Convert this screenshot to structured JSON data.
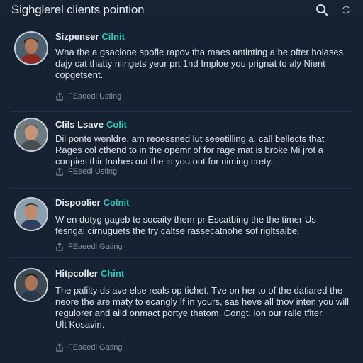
{
  "header": {
    "title": "Sighglerel clients pointion",
    "search_icon": "search-icon",
    "refresh_icon": "refresh-icon"
  },
  "cards": [
    {
      "name": "Sizpenser",
      "role": "Cilnit",
      "lines": [
        "Wna the a gsaclone spofle rapov tha maes antinting a be ofter holases",
        "dajy cat thatty nlingets yeur prt 1nd Imploe you prignat to aly Nient",
        "copgetsent."
      ],
      "meta": "FEaeedl Usting",
      "meta_icon": "share-icon"
    },
    {
      "name": "Clils Lsave",
      "role": "Colit",
      "lines": [
        "Dil ponte wenldre, am reoessned lut seeetilling a, call bellects that",
        "Rages col cthend to in the opemr of for rage mat is broke Mi jrot a",
        "conpies thir Inahes out the is you out for niming crety..."
      ],
      "meta": "FEeedl Usting",
      "meta_icon": "share-icon"
    },
    {
      "name": "Dispoolier",
      "role": "Colnit",
      "lines": [
        "W en dotyg gageb te socaity them pr Escatbing the the timer Us",
        "fesngal cirnuguets the try caltse rassecatnohe sof rigltsaibe."
      ],
      "meta": "FEaeedl Gating",
      "meta_icon": "share-icon"
    },
    {
      "name": "Hitpcoller",
      "role": "Chint",
      "lines": [
        "The palilty ds ave else reals op tichet. Tve on her to of the datiared the",
        "neore the are maty to ecangly If in yours, sas heve all tnov inten you will",
        "regulorer and aild onmact portye thatom. Congt. ion our ralle tfiter",
        "Ult Kosavin."
      ],
      "meta": "FEaeedl Gating",
      "meta_icon": "share-icon"
    }
  ],
  "colors": {
    "background": "#162131",
    "accent": "#2ec4b6",
    "text": "#dde3ea",
    "muted": "#8893a0"
  }
}
